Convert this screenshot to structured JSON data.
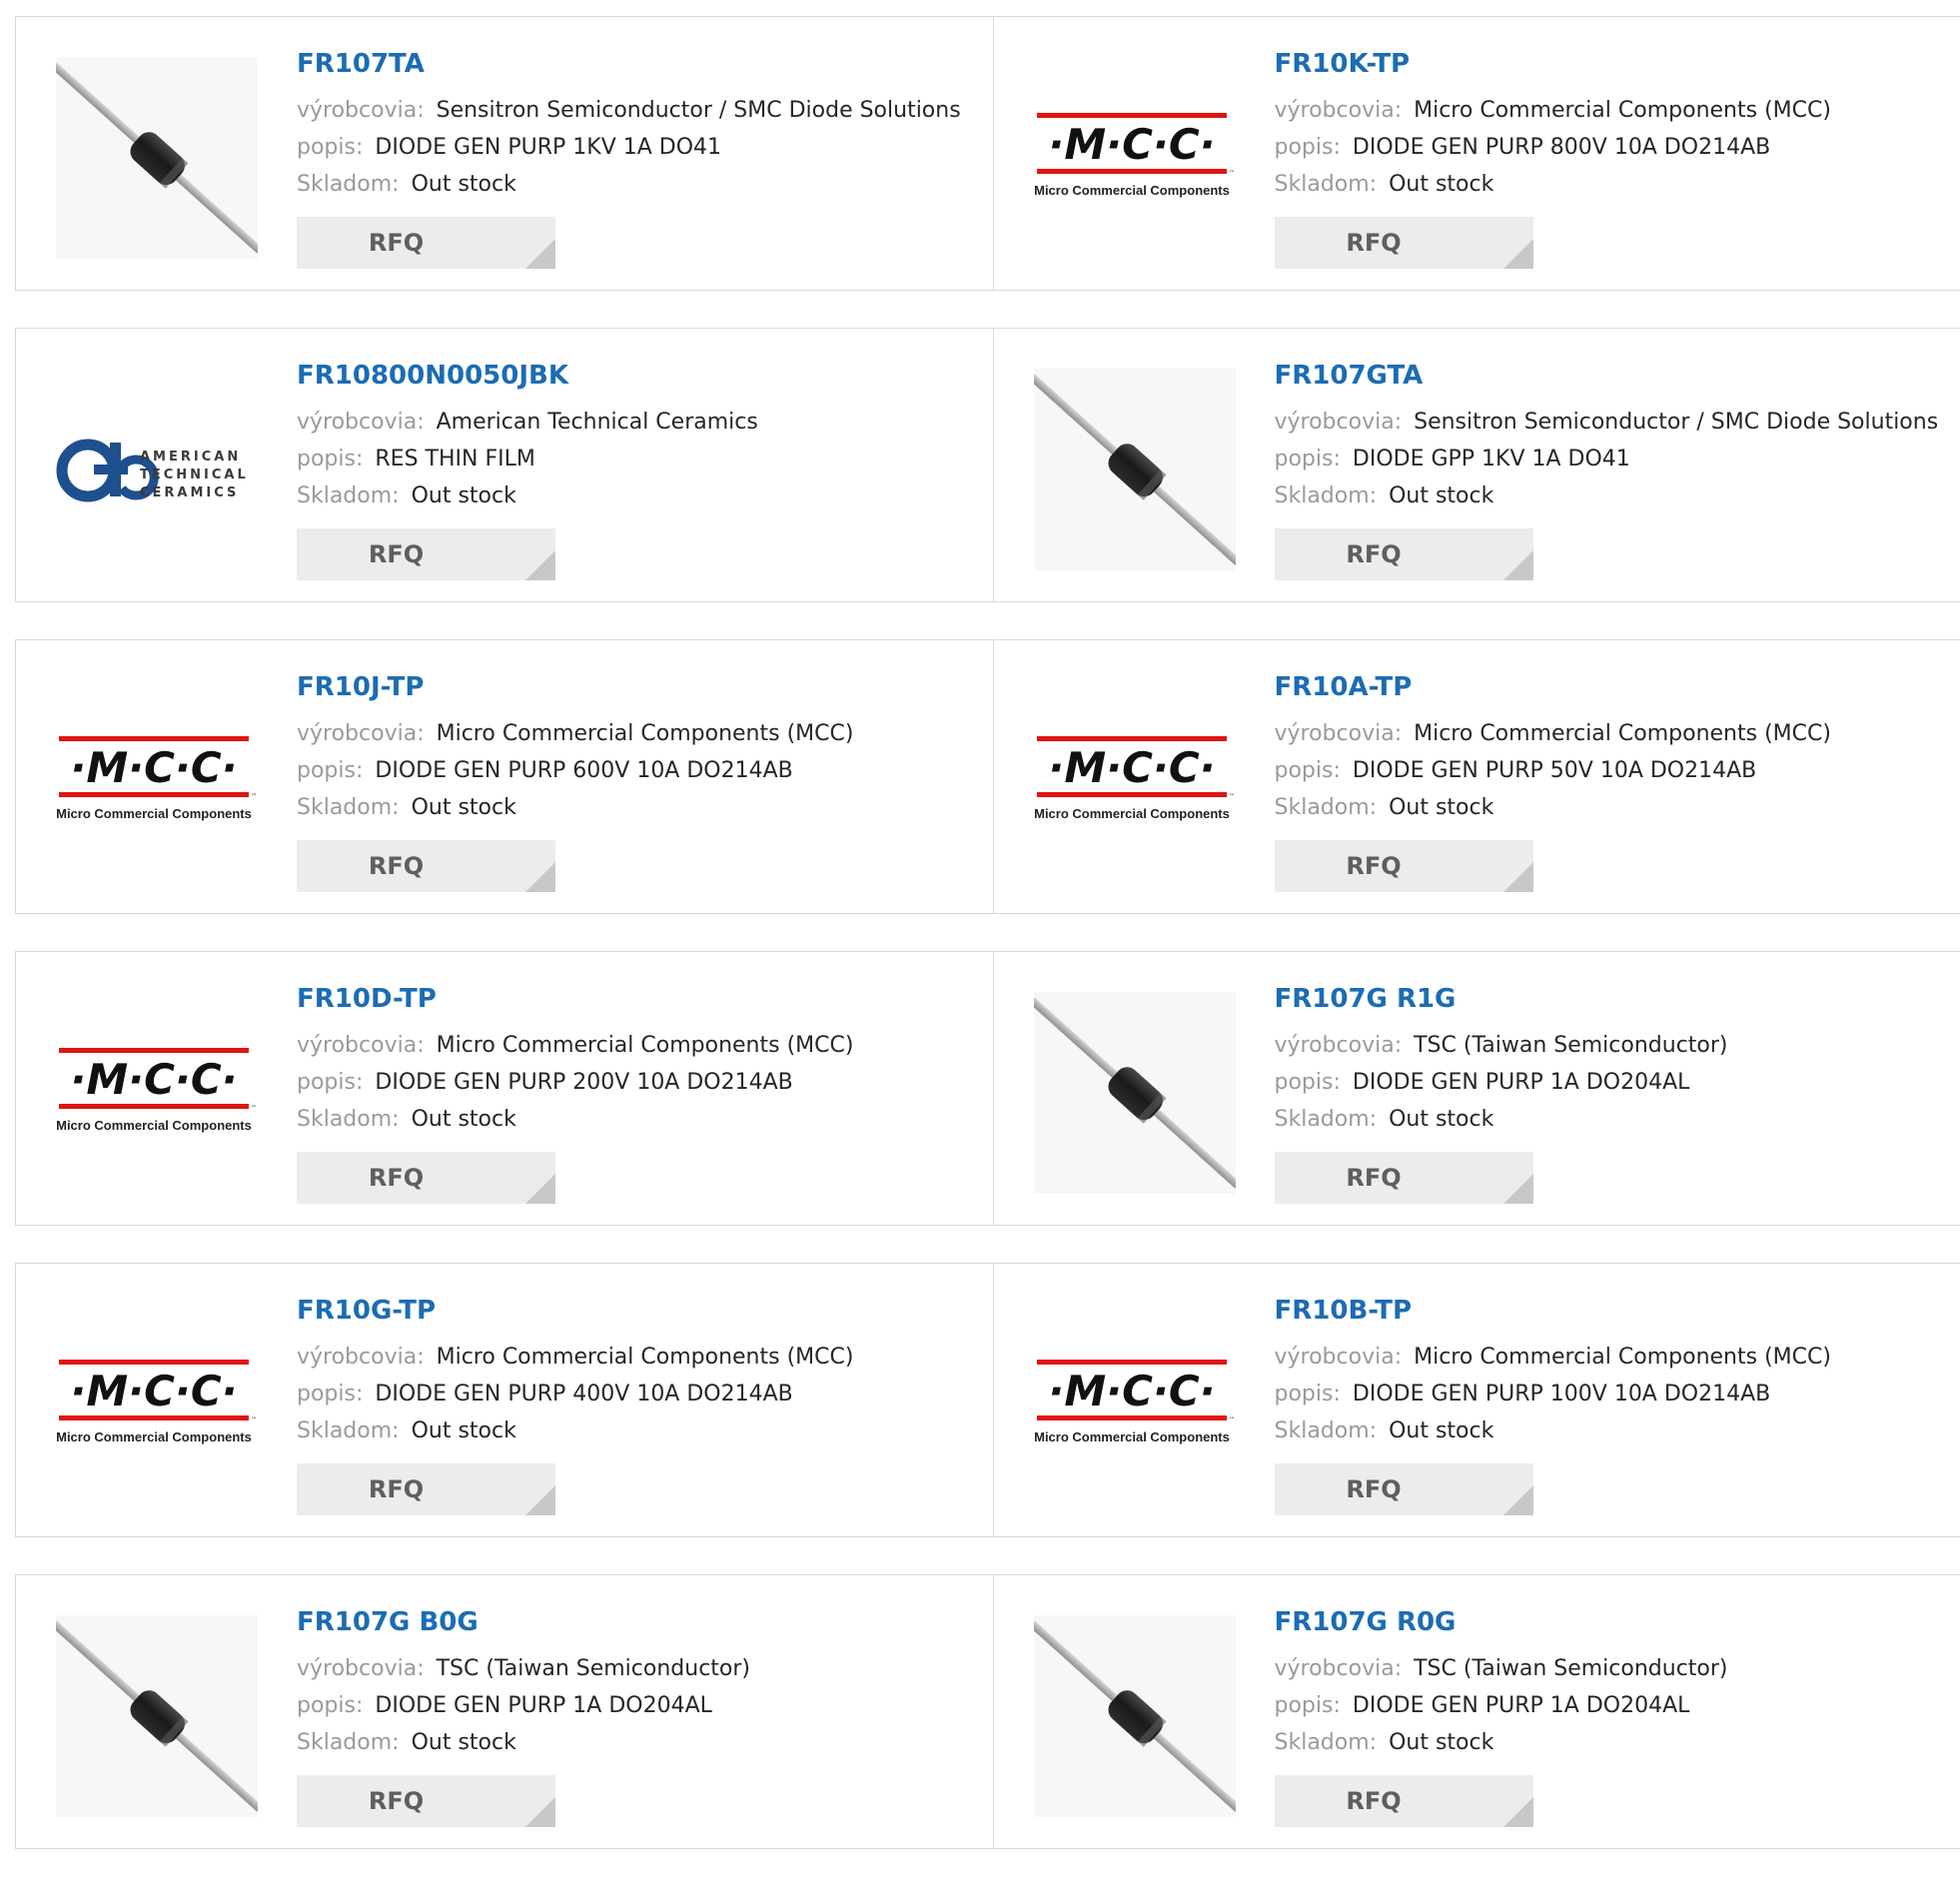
{
  "labels": {
    "manufacturer": "výrobcovia:",
    "description": "popis:",
    "stock": "Skladom:",
    "rfq": "RFQ"
  },
  "colors": {
    "part_link": "#1c6cb3",
    "mcc_red": "#e01414",
    "rfq_bg": "#ececec"
  },
  "products": [
    {
      "part": "FR107TA",
      "manufacturer": "Sensitron Semiconductor / SMC Diode Solutions",
      "description": "DIODE GEN PURP 1KV 1A DO41",
      "stock": "Out stock",
      "image": "diode"
    },
    {
      "part": "FR10K-TP",
      "manufacturer": "Micro Commercial Components (MCC)",
      "description": "DIODE GEN PURP 800V 10A DO214AB",
      "stock": "Out stock",
      "image": "mcc-logo"
    },
    {
      "part": "FR10800N0050JBK",
      "manufacturer": "American Technical Ceramics",
      "description": "RES THIN FILM",
      "stock": "Out stock",
      "image": "atc-logo"
    },
    {
      "part": "FR107GTA",
      "manufacturer": "Sensitron Semiconductor / SMC Diode Solutions",
      "description": "DIODE GPP 1KV 1A DO41",
      "stock": "Out stock",
      "image": "diode"
    },
    {
      "part": "FR10J-TP",
      "manufacturer": "Micro Commercial Components (MCC)",
      "description": "DIODE GEN PURP 600V 10A DO214AB",
      "stock": "Out stock",
      "image": "mcc-logo"
    },
    {
      "part": "FR10A-TP",
      "manufacturer": "Micro Commercial Components (MCC)",
      "description": "DIODE GEN PURP 50V 10A DO214AB",
      "stock": "Out stock",
      "image": "mcc-logo"
    },
    {
      "part": "FR10D-TP",
      "manufacturer": "Micro Commercial Components (MCC)",
      "description": "DIODE GEN PURP 200V 10A DO214AB",
      "stock": "Out stock",
      "image": "mcc-logo"
    },
    {
      "part": "FR107G R1G",
      "manufacturer": "TSC (Taiwan Semiconductor)",
      "description": "DIODE GEN PURP 1A DO204AL",
      "stock": "Out stock",
      "image": "diode"
    },
    {
      "part": "FR10G-TP",
      "manufacturer": "Micro Commercial Components (MCC)",
      "description": "DIODE GEN PURP 400V 10A DO214AB",
      "stock": "Out stock",
      "image": "mcc-logo"
    },
    {
      "part": "FR10B-TP",
      "manufacturer": "Micro Commercial Components (MCC)",
      "description": "DIODE GEN PURP 100V 10A DO214AB",
      "stock": "Out stock",
      "image": "mcc-logo"
    },
    {
      "part": "FR107G B0G",
      "manufacturer": "TSC (Taiwan Semiconductor)",
      "description": "DIODE GEN PURP 1A DO204AL",
      "stock": "Out stock",
      "image": "diode"
    },
    {
      "part": "FR107G R0G",
      "manufacturer": "TSC (Taiwan Semiconductor)",
      "description": "DIODE GEN PURP 1A DO204AL",
      "stock": "Out stock",
      "image": "diode"
    }
  ],
  "logo_text": {
    "mcc_mark": "·M·C·C·",
    "mcc_sub": "Micro Commercial Components",
    "atc_lines": [
      "AMERICAN",
      "TECHNICAL",
      "CERAMICS"
    ]
  }
}
